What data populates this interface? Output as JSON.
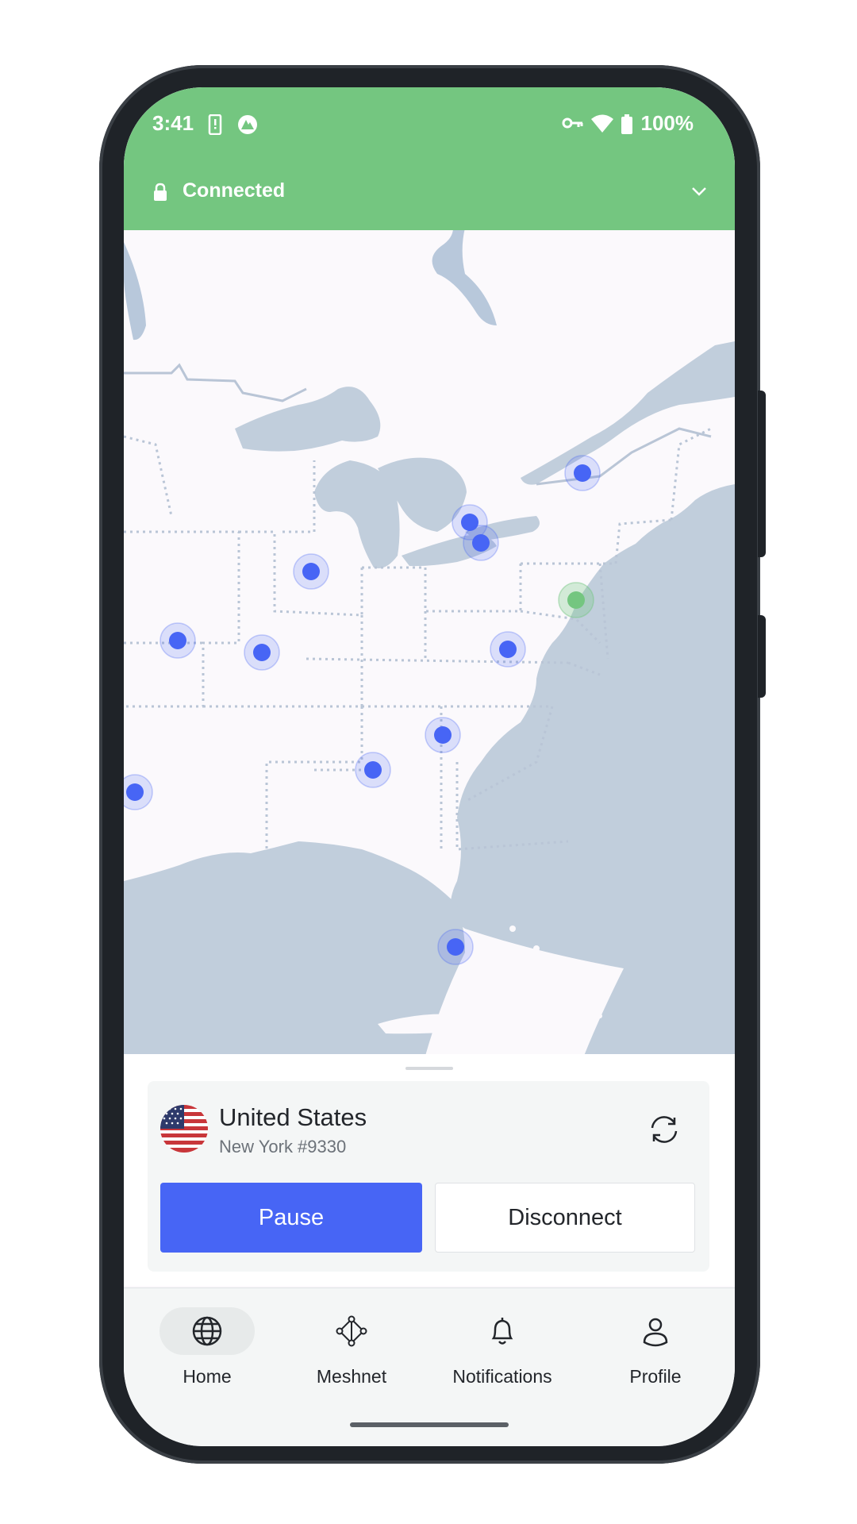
{
  "status_bar": {
    "time": "3:41",
    "battery": "100%",
    "icons": [
      "alert-phone-icon",
      "nordvpn-logo-icon",
      "vpn-key-icon",
      "wifi-icon",
      "battery-icon"
    ]
  },
  "connection_banner": {
    "status": "Connected",
    "lock_icon": "lock-icon",
    "expand_icon": "chevron-down-icon"
  },
  "colors": {
    "connected_green": "#74c680",
    "accent_blue": "#4765f5",
    "map_water": "#c1cedc",
    "map_land": "#fbf9fc"
  },
  "map": {
    "servers": [
      {
        "id": "toronto",
        "kind": "available"
      },
      {
        "id": "buffalo",
        "kind": "available"
      },
      {
        "id": "montreal",
        "kind": "available"
      },
      {
        "id": "chicago",
        "kind": "available"
      },
      {
        "id": "kansas-city",
        "kind": "available"
      },
      {
        "id": "st-louis",
        "kind": "available"
      },
      {
        "id": "washington",
        "kind": "available"
      },
      {
        "id": "charlotte",
        "kind": "available"
      },
      {
        "id": "atlanta",
        "kind": "available"
      },
      {
        "id": "dallas",
        "kind": "available"
      },
      {
        "id": "miami",
        "kind": "available"
      },
      {
        "id": "new-york",
        "kind": "connected"
      }
    ]
  },
  "connection_card": {
    "country": "United States",
    "server": "New York #9330",
    "flag_icon": "us-flag-icon",
    "refresh_icon": "refresh-icon",
    "pause_label": "Pause",
    "disconnect_label": "Disconnect"
  },
  "bottom_nav": {
    "items": [
      {
        "label": "Home",
        "icon": "globe-icon",
        "active": true
      },
      {
        "label": "Meshnet",
        "icon": "meshnet-icon",
        "active": false
      },
      {
        "label": "Notifications",
        "icon": "bell-icon",
        "active": false
      },
      {
        "label": "Profile",
        "icon": "profile-icon",
        "active": false
      }
    ]
  }
}
